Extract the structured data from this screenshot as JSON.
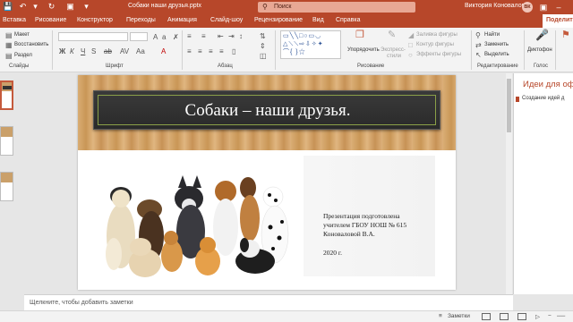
{
  "titlebar": {
    "doc_title": "Собаки наши друзья.pptx",
    "search_placeholder": "Поиск",
    "user_name": "Виктория Коновалова",
    "user_initials": "ВК",
    "accent": "#b7472a"
  },
  "tabs": [
    "Вставка",
    "Рисование",
    "Конструктор",
    "Переходы",
    "Анимация",
    "Слайд-шоу",
    "Рецензирование",
    "Вид",
    "Справка"
  ],
  "share_label": "Поделит",
  "ribbon": {
    "slides_group": {
      "layout": "Макет",
      "reset": "Восстановить",
      "section": "Раздел",
      "label": "Слайды"
    },
    "font_group": {
      "label": "Шрифт"
    },
    "paragraph_group": {
      "label": "Абзац"
    },
    "drawing_group": {
      "arrange": "Упорядочить",
      "quick_styles_1": "Экспресс-",
      "quick_styles_2": "стили",
      "fill": "Заливка фигуры",
      "outline": "Контур фигуры",
      "effects": "Эффекты фигуры",
      "label": "Рисование"
    },
    "editing_group": {
      "find": "Найти",
      "replace": "Заменить",
      "select": "Выделить",
      "label": "Редактирование"
    },
    "voice_group": {
      "dictate": "Диктофон",
      "label": "Голос"
    },
    "designer_partial": "Иде\nоф"
  },
  "slide": {
    "title": "Собаки – наши друзья.",
    "caption_line1": "Презентация подготовлена",
    "caption_line2": "учителем ГБОУ НОШ № 615",
    "caption_line3": "Коноваловой В.А.",
    "year": "2020 г."
  },
  "design_pane": {
    "title": "Идеи для оф",
    "item": "Создание идей д"
  },
  "notes_placeholder": "Щелкните, чтобы добавить заметки",
  "status": {
    "notes": "Заметки",
    "zoom_minus": "−"
  }
}
